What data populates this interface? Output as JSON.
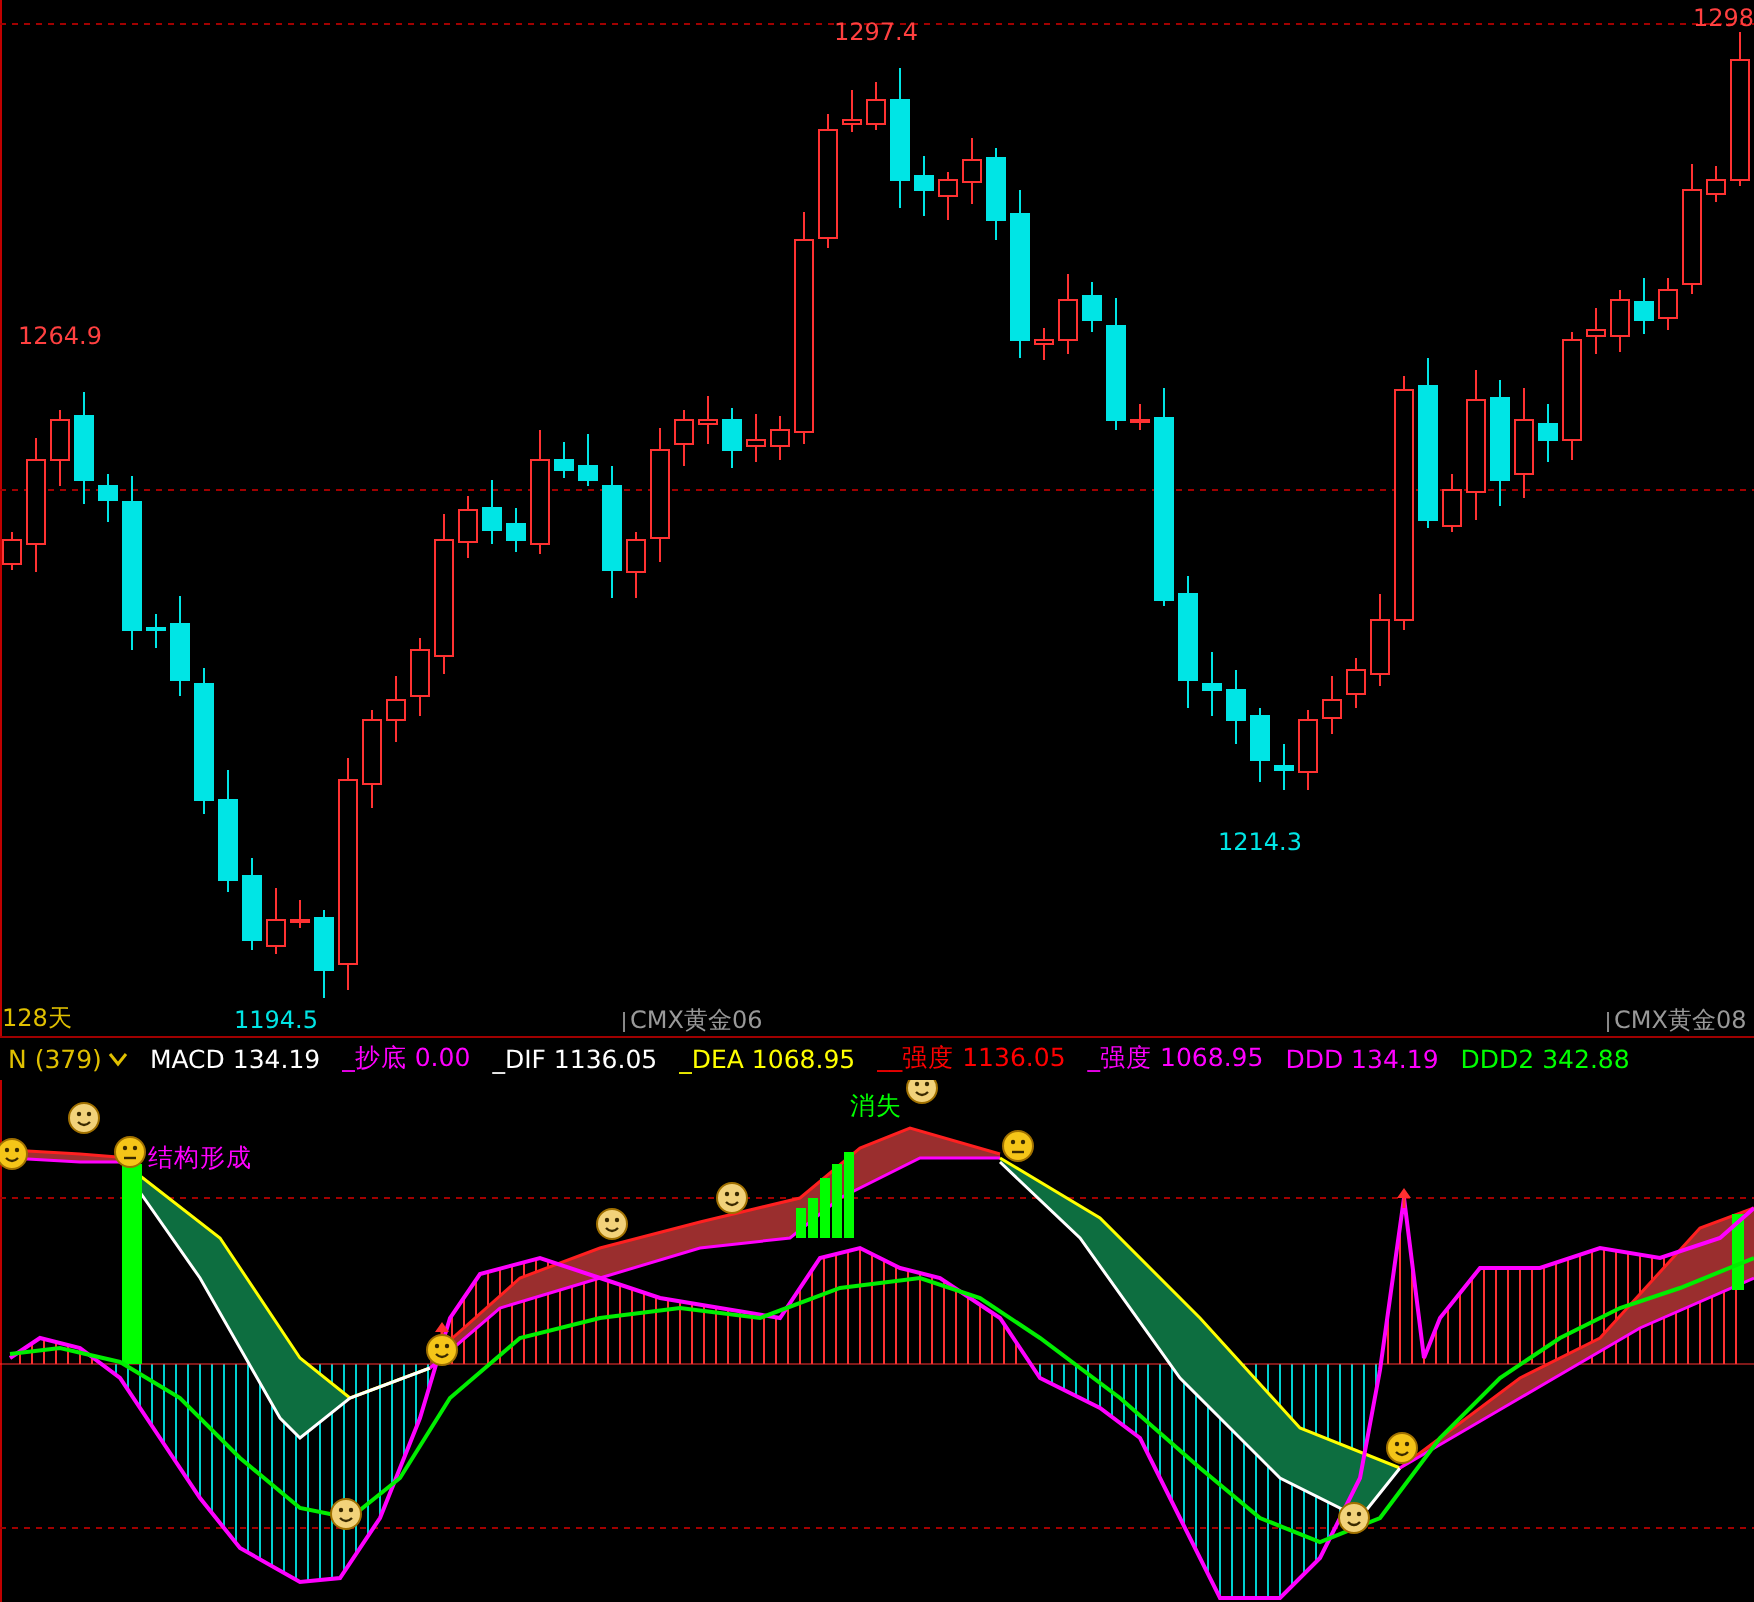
{
  "price_chart": {
    "price_labels": [
      {
        "text": "1297.4",
        "kind": "high"
      },
      {
        "text": "1298",
        "kind": "high"
      },
      {
        "text": "1264.9",
        "kind": "high"
      },
      {
        "text": "1194.5",
        "kind": "low"
      },
      {
        "text": "1214.3",
        "kind": "low"
      }
    ]
  },
  "time_axis": {
    "period": "128天",
    "contracts": [
      "CMX黄金06",
      "CMX黄金08"
    ]
  },
  "indicator": {
    "name": "N (379)",
    "readouts": [
      {
        "text": "MACD 134.19",
        "color": "#ffffff"
      },
      {
        "text": "_抄底 0.00",
        "color": "#ff00ff"
      },
      {
        "text": "_DIF 1136.05",
        "color": "#ffffff"
      },
      {
        "text": "_DEA 1068.95",
        "color": "#ffff00"
      },
      {
        "text": "__强度 1136.05",
        "color": "#ff0000"
      },
      {
        "text": "_强度 1068.95",
        "color": "#ff00ff"
      },
      {
        "text": "DDD 134.19",
        "color": "#ff00ff"
      },
      {
        "text": "DDD2 342.88",
        "color": "#00ff00"
      }
    ],
    "signals": [
      {
        "text": "结构形成",
        "color": "#ff00ff"
      },
      {
        "text": "消失",
        "color": "#00ff00"
      }
    ]
  }
}
